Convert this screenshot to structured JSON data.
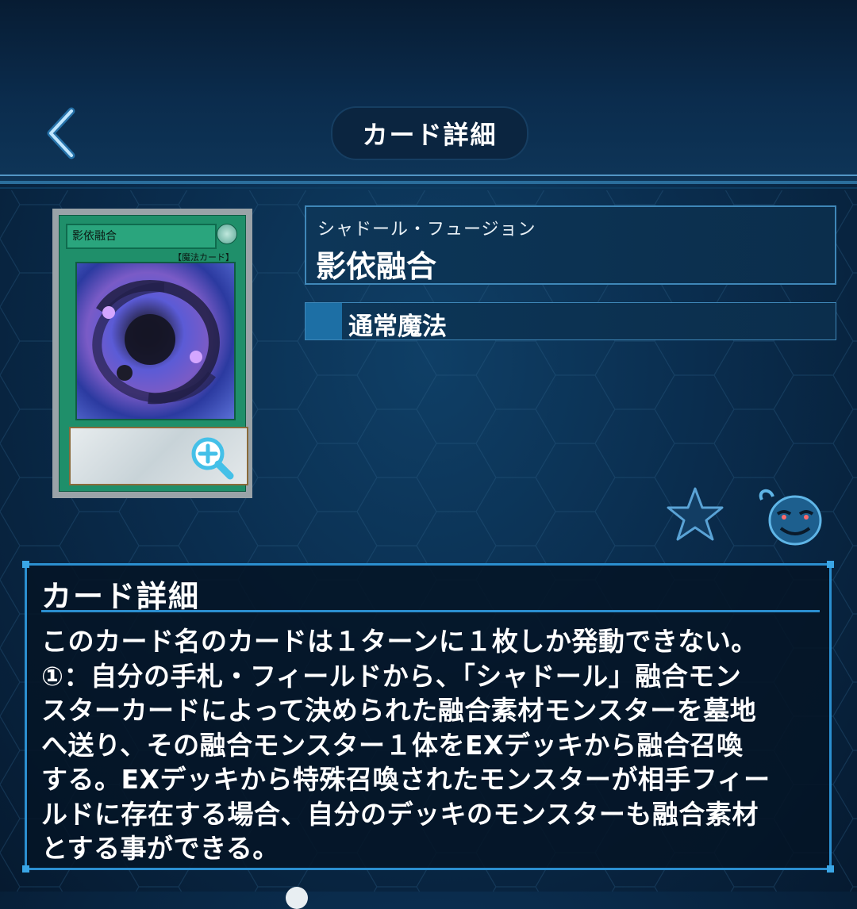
{
  "header": {
    "title": "カード詳細"
  },
  "card": {
    "image_name": "影依融合",
    "image_type": "【魔法カード】",
    "name_ruby": "シャドール・フュージョン",
    "name": "影依融合",
    "type": "通常魔法"
  },
  "detail": {
    "heading": "カード詳細",
    "text": "このカード名のカードは１ターンに１枚しか発動できない。\n①：自分の手札・フィールドから、「シャドール」融合モン\nスターカードによって決められた融合素材モンスターを墓地\nへ送り、その融合モンスター１体をEXデッキから融合召喚\nする。EXデッキから特殊召喚されたモンスターが相手フィー\nルドに存在する場合、自分のデッキのモンスターも融合素材\nとする事ができる。"
  },
  "icons": {
    "back": "chevron-left-icon",
    "zoom": "zoom-in-icon",
    "favorite": "star-icon",
    "pot": "pot-of-greed-icon"
  },
  "colors": {
    "accent": "#2b8fd0",
    "background": "#0a2d4e"
  }
}
